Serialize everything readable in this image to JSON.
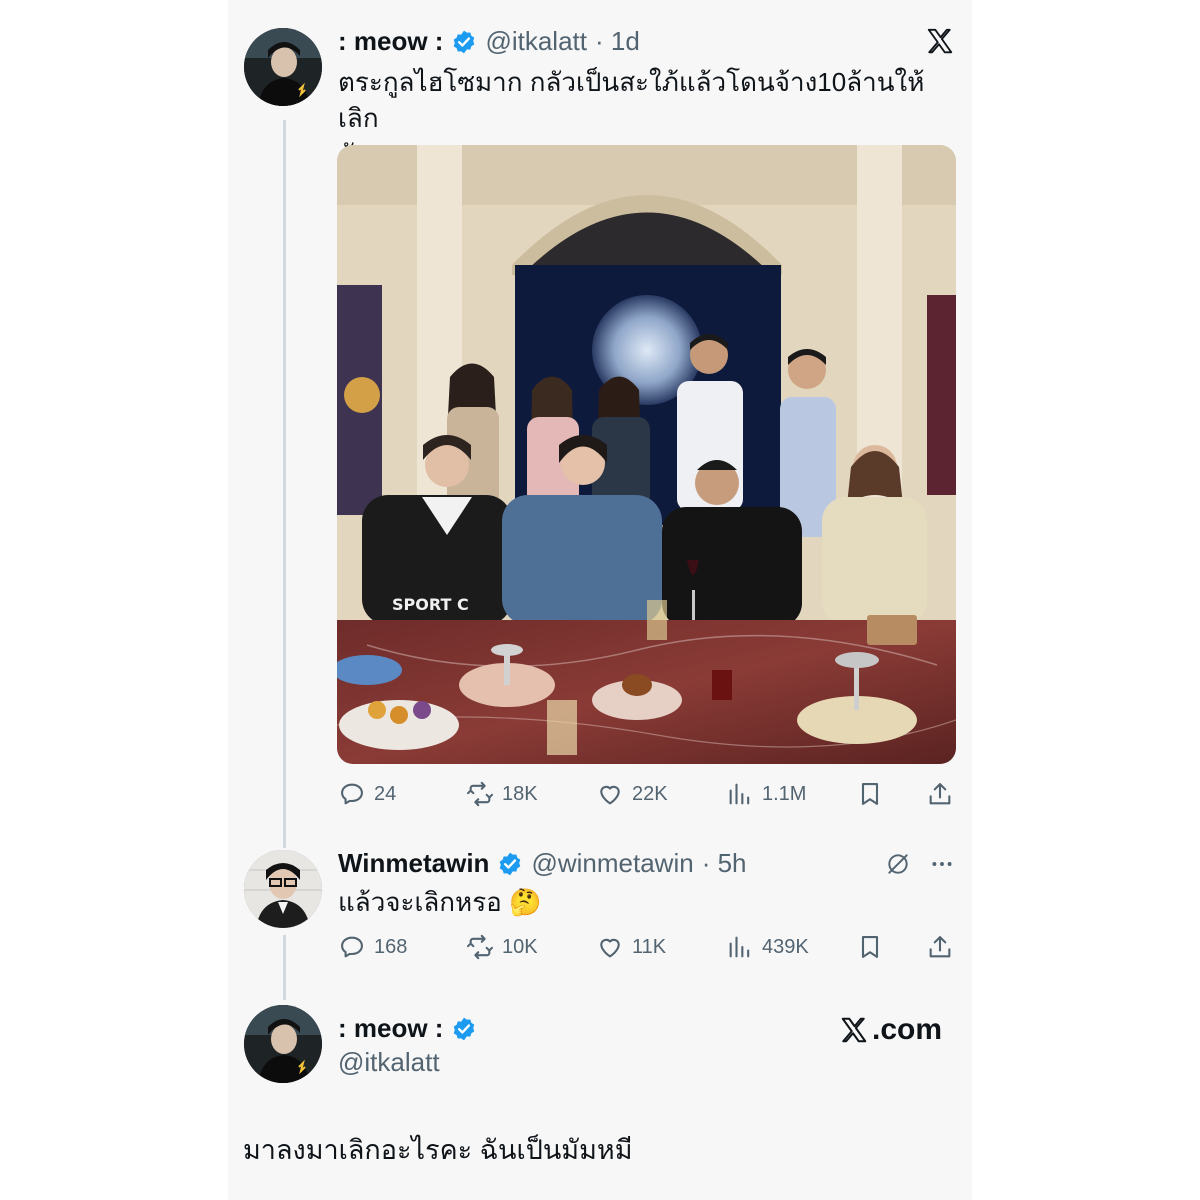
{
  "tweet_main": {
    "display_name": ": meow :",
    "handle": "@itkalatt",
    "time": "· 1d",
    "text_line1": "ตระกูลไฮโซมาก กลัวเป็นสะใภ้แล้วโดนจ้าง10ล้านให้เลิก",
    "text_line2": "กับลูกชาย",
    "replies": "24",
    "reposts": "18K",
    "likes": "22K",
    "views": "1.1M"
  },
  "tweet_reply": {
    "display_name": "Winmetawin",
    "handle": "@winmetawin",
    "time": "· 5h",
    "text": "แล้วจะเลิกหรอ 🤔",
    "replies": "168",
    "reposts": "10K",
    "likes": "11K",
    "views": "439K"
  },
  "footer_card": {
    "display_name": ": meow :",
    "handle": "@itkalatt",
    "site": ".com",
    "text": "มาลงมาเลิกอะไรคะ ฉันเป็นมัมหมี"
  },
  "colors": {
    "verified_blue": "#1d9bf0",
    "text_primary": "#0f1419",
    "text_secondary": "#536471",
    "thread_line": "#cfd9de"
  },
  "icons": [
    "x-logo-icon",
    "verified-icon",
    "reply-icon",
    "repost-icon",
    "like-icon",
    "views-icon",
    "bookmark-icon",
    "share-icon",
    "grok-icon",
    "more-icon"
  ]
}
